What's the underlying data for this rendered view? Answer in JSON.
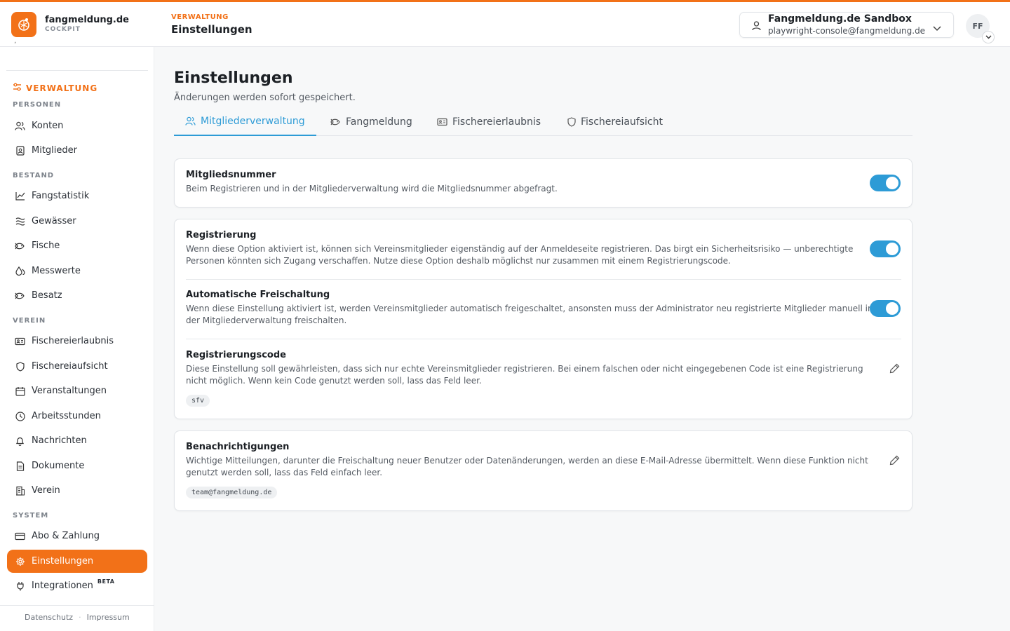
{
  "brand": {
    "name": "fangmeldung.de",
    "sub": "COCKPIT"
  },
  "header": {
    "section": "VERWALTUNG",
    "title": "Einstellungen"
  },
  "account": {
    "name": "Fangmeldung.de Sandbox",
    "email": "playwright-console@fangmeldung.de",
    "icon": "user-icon"
  },
  "avatar": {
    "initials": "FF"
  },
  "sidebar": {
    "section_title": "VERWALTUNG",
    "groups": {
      "personen": "PERSONEN",
      "bestand": "BESTAND",
      "verein": "VEREIN",
      "system": "SYSTEM"
    },
    "items": [
      {
        "label": "Konten",
        "icon": "users-icon"
      },
      {
        "label": "Mitglieder",
        "icon": "member-card-icon"
      },
      {
        "label": "Fangstatistik",
        "icon": "line-chart-icon"
      },
      {
        "label": "Gewässer",
        "icon": "waves-icon"
      },
      {
        "label": "Fische",
        "icon": "fish-icon"
      },
      {
        "label": "Messwerte",
        "icon": "droplets-icon"
      },
      {
        "label": "Besatz",
        "icon": "fish-icon"
      },
      {
        "label": "Fischereierlaubnis",
        "icon": "id-card-icon"
      },
      {
        "label": "Fischereiaufsicht",
        "icon": "shield-icon"
      },
      {
        "label": "Veranstaltungen",
        "icon": "calendar-icon"
      },
      {
        "label": "Arbeitsstunden",
        "icon": "clock-icon"
      },
      {
        "label": "Nachrichten",
        "icon": "bell-icon"
      },
      {
        "label": "Dokumente",
        "icon": "document-icon"
      },
      {
        "label": "Verein",
        "icon": "building-icon"
      },
      {
        "label": "Abo & Zahlung",
        "icon": "credit-card-icon"
      },
      {
        "label": "Einstellungen",
        "icon": "gear-icon"
      },
      {
        "label": "Integrationen",
        "icon": "plug-icon",
        "badge": "BETA"
      }
    ],
    "footer": {
      "privacy": "Datenschutz",
      "separator": "·",
      "imprint": "Impressum"
    }
  },
  "page": {
    "title": "Einstellungen",
    "subtitle": "Änderungen werden sofort gespeichert."
  },
  "tabs": [
    {
      "label": "Mitgliederverwaltung",
      "icon": "users-icon",
      "active": true
    },
    {
      "label": "Fangmeldung",
      "icon": "fish-icon",
      "active": false
    },
    {
      "label": "Fischereierlaubnis",
      "icon": "id-card-icon",
      "active": false
    },
    {
      "label": "Fischereiaufsicht",
      "icon": "shield-icon",
      "active": false
    }
  ],
  "settings": {
    "member_number": {
      "title": "Mitgliedsnummer",
      "desc": "Beim Registrieren und in der Mitgliederverwaltung wird die Mitgliedsnummer abgefragt.",
      "enabled": true
    },
    "registration": {
      "title": "Registrierung",
      "desc": "Wenn diese Option aktiviert ist, können sich Vereinsmitglieder eigenständig auf der Anmeldeseite registrieren. Das birgt ein Sicherheitsrisiko — unberechtigte Personen könnten sich Zugang verschaffen. Nutze diese Option deshalb möglichst nur zusammen mit einem Registrierungscode.",
      "enabled": true
    },
    "auto_unlock": {
      "title": "Automatische Freischaltung",
      "desc": "Wenn diese Einstellung aktiviert ist, werden Vereinsmitglieder automatisch freigeschaltet, ansonsten muss der Administrator neu registrierte Mitglieder manuell in der Mitgliederverwaltung freischalten.",
      "enabled": true
    },
    "reg_code": {
      "title": "Registrierungscode",
      "desc": "Diese Einstellung soll gewährleisten, dass sich nur echte Vereinsmitglieder registrieren. Bei einem falschen oder nicht eingegebenen Code ist eine Registrierung nicht möglich. Wenn kein Code genutzt werden soll, lass das Feld leer.",
      "value": "sfv"
    },
    "notifications": {
      "title": "Benachrichtigungen",
      "desc": "Wichtige Mitteilungen, darunter die Freischaltung neuer Benutzer oder Datenänderungen, werden an diese E-Mail-Adresse übermittelt. Wenn diese Funktion nicht genutzt werden soll, lass das Feld einfach leer.",
      "value": "team@fangmeldung.de"
    }
  },
  "colors": {
    "accent": "#f27118",
    "toggle_on": "#2d9bd6",
    "tab_active": "#2d9bd6"
  }
}
